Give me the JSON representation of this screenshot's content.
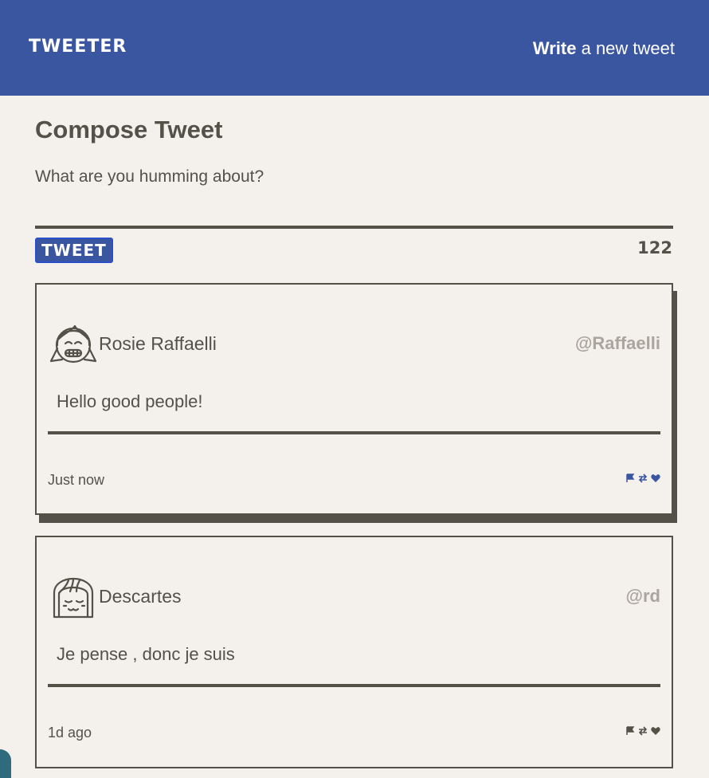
{
  "nav": {
    "brand": "TWEETER",
    "write_bold": "Write",
    "write_rest": " a new tweet"
  },
  "compose": {
    "title": "Compose Tweet",
    "placeholder": "What are you humming about?",
    "button_label": "TWEET",
    "counter": "122"
  },
  "tweets": [
    {
      "name": "Rosie Raffaelli",
      "handle": "@Raffaelli",
      "text": "Hello good people!",
      "time": "Just now",
      "avatar_icon": "girl-pigtails-avatar-icon",
      "action_color": "#3b56a0"
    },
    {
      "name": "Descartes",
      "handle": "@rd",
      "text": "Je pense , donc je suis",
      "time": "1d ago",
      "avatar_icon": "girl-bob-avatar-icon",
      "action_color": "#545149"
    }
  ],
  "colors": {
    "brand_blue": "#3b56a0",
    "ink": "#545149",
    "background": "#f4f1ec",
    "handle_gray": "#aaa59d"
  }
}
